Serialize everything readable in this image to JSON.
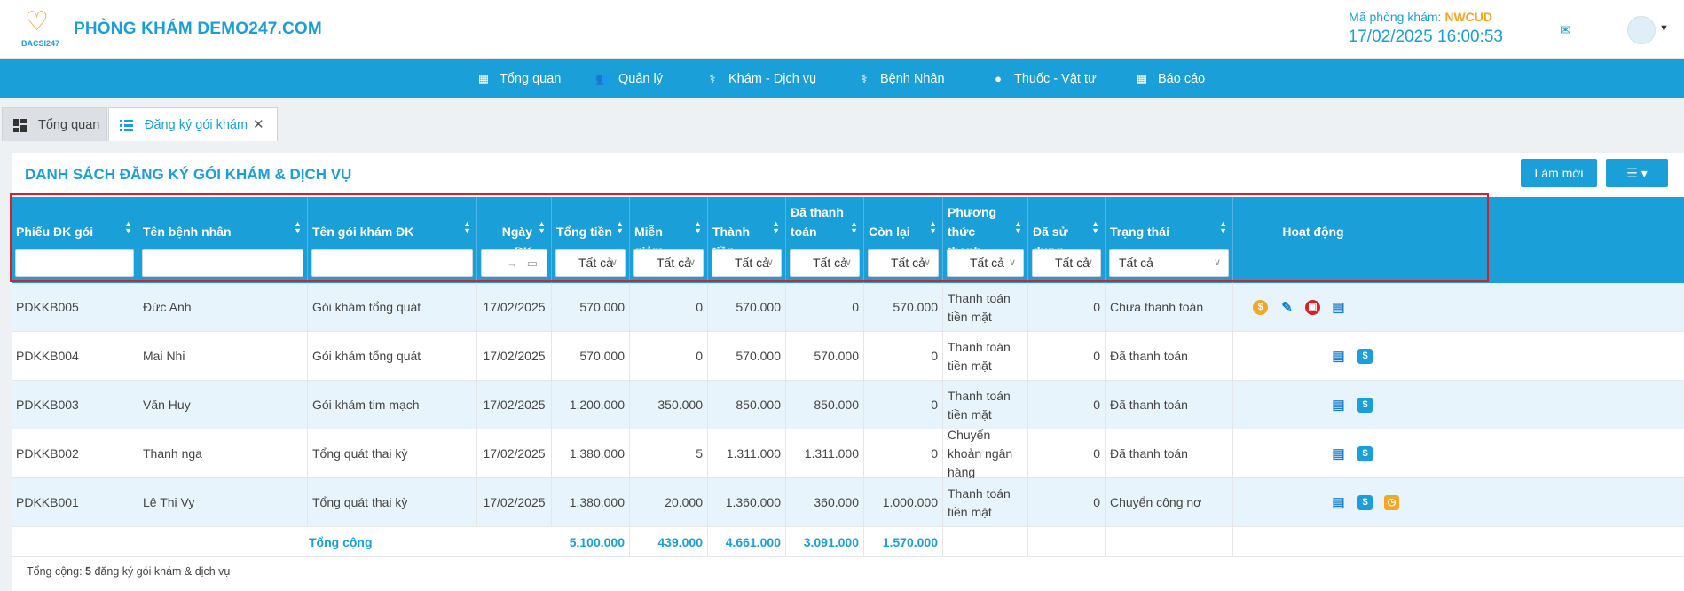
{
  "header": {
    "logo_text": "BACSI247",
    "clinic_name": "PHÒNG KHÁM DEMO247.COM",
    "clinic_code_label": "Mã phòng khám:",
    "clinic_code": "NWCUD",
    "datetime": "17/02/2025 16:00:53"
  },
  "nav": [
    {
      "label": "Tổng quan",
      "icon": "dashboard-icon"
    },
    {
      "label": "Quản lý",
      "icon": "users-icon"
    },
    {
      "label": "Khám - Dịch vụ",
      "icon": "doctor-icon"
    },
    {
      "label": "Bệnh Nhân",
      "icon": "patient-icon"
    },
    {
      "label": "Thuốc - Vật tư",
      "icon": "pills-icon"
    },
    {
      "label": "Báo cáo",
      "icon": "report-icon"
    }
  ],
  "tabs": [
    {
      "label": "Tổng quan"
    },
    {
      "label": "Đăng ký gói khám"
    }
  ],
  "panel": {
    "title": "DANH SÁCH ĐĂNG KÝ GÓI KHÁM & DỊCH VỤ",
    "refresh_label": "Làm mới"
  },
  "columns": [
    {
      "label": "Phiếu ĐK gói"
    },
    {
      "label": "Tên bệnh nhân"
    },
    {
      "label": "Tên gói khám ĐK"
    },
    {
      "label": "Ngày ĐK"
    },
    {
      "label": "Tổng tiền"
    },
    {
      "label": "Miễn giảm"
    },
    {
      "label": "Thành tiền"
    },
    {
      "label": "Đã thanh toán"
    },
    {
      "label": "Còn lại"
    },
    {
      "label": "Phương thức thanh toán"
    },
    {
      "label": "Đã sử dụng"
    },
    {
      "label": "Trạng thái"
    },
    {
      "label": "Hoạt động"
    }
  ],
  "filter_all": "Tất cả",
  "rows": [
    {
      "code": "PDKKB005",
      "patient": "Đức Anh",
      "package": "Gói khám tổng quát",
      "date": "17/02/2025",
      "total": "570.000",
      "discount": "0",
      "amount": "570.000",
      "paid": "0",
      "remaining": "570.000",
      "method": "Thanh toán tiền mặt",
      "used": "0",
      "status": "Chưa thanh toán"
    },
    {
      "code": "PDKKB004",
      "patient": "Mai Nhi",
      "package": "Gói khám tổng quát",
      "date": "17/02/2025",
      "total": "570.000",
      "discount": "0",
      "amount": "570.000",
      "paid": "570.000",
      "remaining": "0",
      "method": "Thanh toán tiền mặt",
      "used": "0",
      "status": "Đã thanh toán"
    },
    {
      "code": "PDKKB003",
      "patient": "Văn Huy",
      "package": "Gói khám tim mạch",
      "date": "17/02/2025",
      "total": "1.200.000",
      "discount": "350.000",
      "amount": "850.000",
      "paid": "850.000",
      "remaining": "0",
      "method": "Thanh toán tiền mặt",
      "used": "0",
      "status": "Đã thanh toán"
    },
    {
      "code": "PDKKB002",
      "patient": "Thanh nga",
      "package": "Tổng quát thai kỳ",
      "date": "17/02/2025",
      "total": "1.380.000",
      "discount": "5",
      "amount": "1.311.000",
      "paid": "1.311.000",
      "remaining": "0",
      "method": "Chuyển khoản ngân hàng",
      "used": "0",
      "status": "Đã thanh toán"
    },
    {
      "code": "PDKKB001",
      "patient": "Lê Thị Vy",
      "package": "Tổng quát thai kỳ",
      "date": "17/02/2025",
      "total": "1.380.000",
      "discount": "20.000",
      "amount": "1.360.000",
      "paid": "360.000",
      "remaining": "1.000.000",
      "method": "Thanh toán tiền mặt",
      "used": "0",
      "status": "Chuyển công nợ"
    }
  ],
  "totals": {
    "label": "Tổng cộng",
    "total": "5.100.000",
    "discount": "439.000",
    "amount": "4.661.000",
    "paid": "3.091.000",
    "remaining": "1.570.000"
  },
  "footer": {
    "prefix": "Tổng cộng:",
    "count": "5",
    "suffix": "đăng ký gói khám & dịch vụ"
  },
  "colors": {
    "primary": "#1a9fd9",
    "accent": "#f5a623",
    "danger": "#d7202a"
  }
}
